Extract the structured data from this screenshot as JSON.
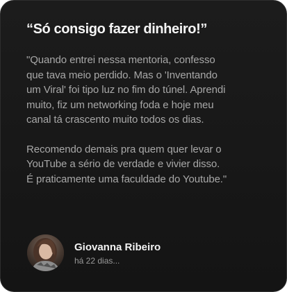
{
  "testimonial": {
    "headline": "“Só consigo fazer dinheiro!”",
    "quote_paragraph_1": "\"Quando entrei nessa mentoria, confesso\nque tava meio perdido. Mas o 'Inventando\num Viral' foi tipo luz no fim do túnel. Aprendi\nmuito, fiz um networking foda e hoje meu\ncanal tá crascento muito todos os dias.",
    "quote_paragraph_2": "Recomendo demais pra quem quer levar o\nYouTube a sério de verdade e vivier disso.\nÉ praticamente uma faculdade do Youtube.\"",
    "author": {
      "name": "Giovanna Ribeiro",
      "posted": "há 22 dias...",
      "avatar_icon": "user-photo-avatar"
    }
  },
  "colors": {
    "card_background": "#181818",
    "headline": "#f5f5f5",
    "body_text": "#a8a8a8",
    "meta_text": "#9a9a9a"
  }
}
